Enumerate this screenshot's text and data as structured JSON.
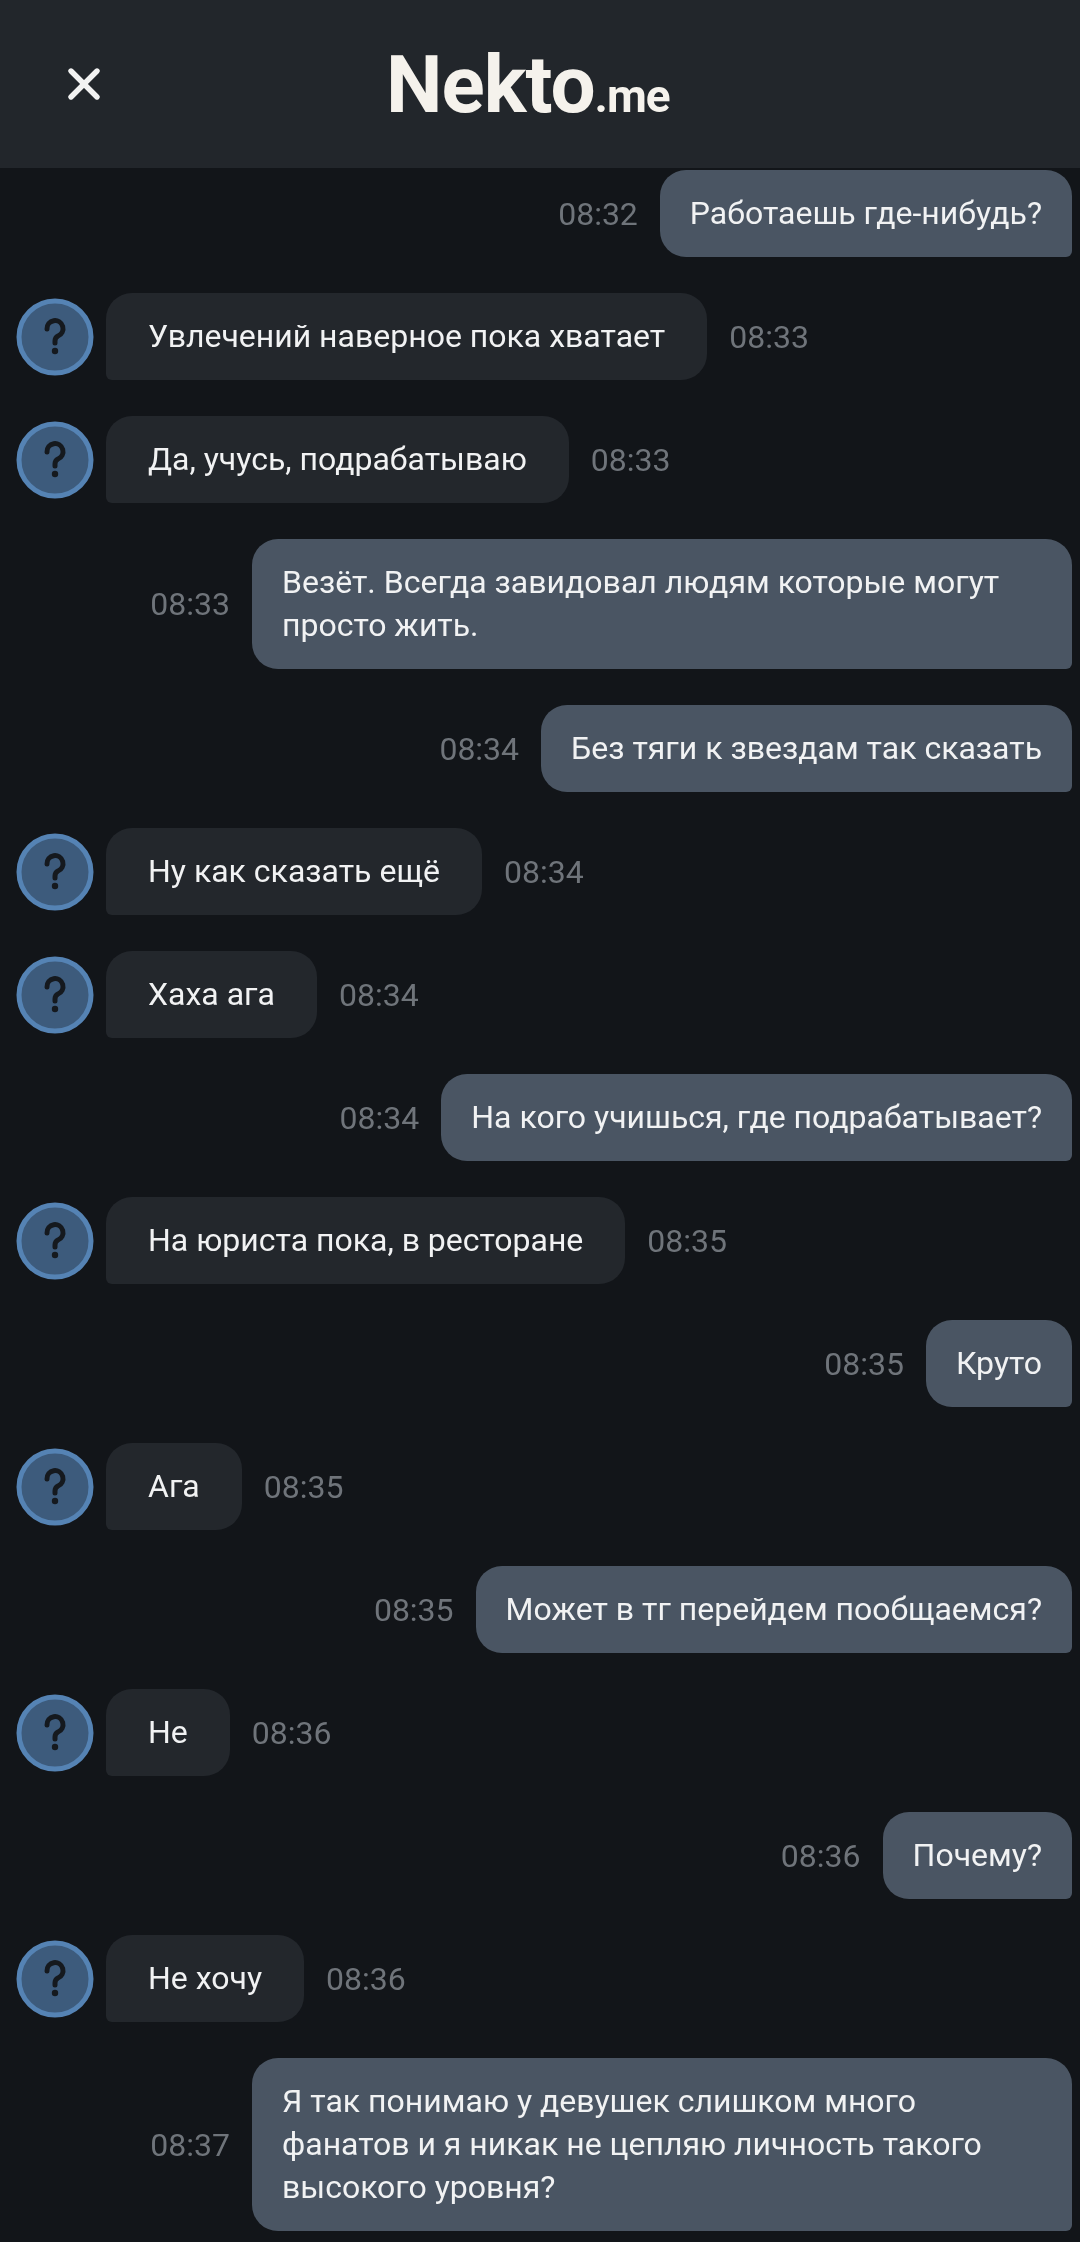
{
  "header": {
    "logo": "Nekto",
    "logo_suffix": ".me"
  },
  "messages": [
    {
      "kind": "sent",
      "text": "Работаешь где-нибудь?",
      "time": "08:32"
    },
    {
      "kind": "received",
      "text": "Увлечений наверное пока хватает",
      "time": "08:33"
    },
    {
      "kind": "received",
      "text": "Да, учусь, подрабатываю",
      "time": "08:33"
    },
    {
      "kind": "sent",
      "text": "Везёт. Всегда завидовал людям которые могут просто жить.",
      "time": "08:33"
    },
    {
      "kind": "sent",
      "text": "Без тяги к звездам так сказать",
      "time": "08:34"
    },
    {
      "kind": "received",
      "text": "Ну как сказать ещё",
      "time": "08:34"
    },
    {
      "kind": "received",
      "text": "Хаха ага",
      "time": "08:34"
    },
    {
      "kind": "sent",
      "text": "На кого учишься, где подрабатывает?",
      "time": "08:34"
    },
    {
      "kind": "received",
      "text": "На юриста пока, в ресторане",
      "time": "08:35"
    },
    {
      "kind": "sent",
      "text": "Круто",
      "time": "08:35"
    },
    {
      "kind": "received",
      "text": "Ага",
      "time": "08:35"
    },
    {
      "kind": "sent",
      "text": "Может в тг перейдем пообщаемся?",
      "time": "08:35"
    },
    {
      "kind": "received",
      "text": "Не",
      "time": "08:36"
    },
    {
      "kind": "sent",
      "text": "Почему?",
      "time": "08:36"
    },
    {
      "kind": "received",
      "text": "Не хочу",
      "time": "08:36"
    },
    {
      "kind": "sent",
      "text": "Я так понимаю у девушек слишком много фанатов и я никак не цепляю личность такого высокого уровня?",
      "time": "08:37"
    }
  ]
}
